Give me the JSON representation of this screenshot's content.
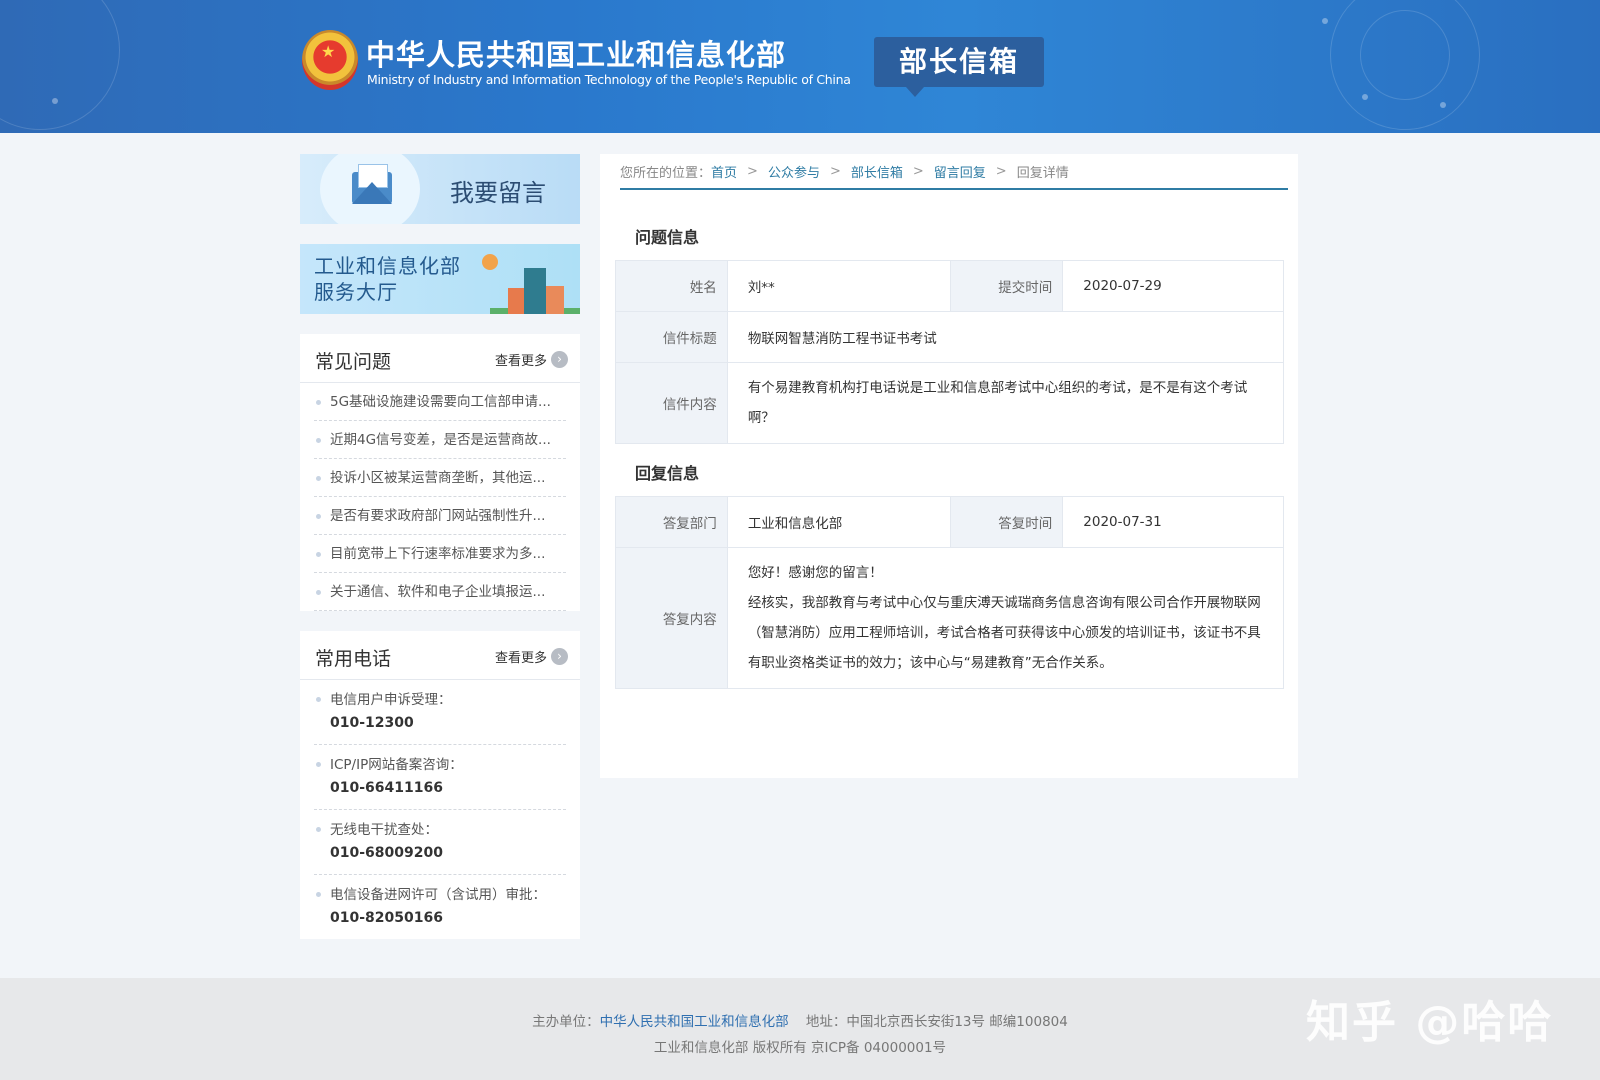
{
  "header": {
    "title_cn": "中华人民共和国工业和信息化部",
    "title_en": "Ministry of Industry and Information Technology of the People's Republic of China",
    "badge": "部长信箱"
  },
  "sidebar": {
    "leave_message": "我要留言",
    "service_hall_line1": "工业和信息化部",
    "service_hall_line2": "服务大厅",
    "faq": {
      "title": "常见问题",
      "more": "查看更多",
      "items": [
        "5G基础设施建设需要向工信部申请...",
        "近期4G信号变差，是否是运营商故...",
        "投诉小区被某运营商垄断，其他运...",
        "是否有要求政府部门网站强制性升...",
        "目前宽带上下行速率标准要求为多...",
        "关于通信、软件和电子企业填报运..."
      ]
    },
    "phones": {
      "title": "常用电话",
      "more": "查看更多",
      "items": [
        {
          "label": "电信用户申诉受理：",
          "number": "010-12300"
        },
        {
          "label": "ICP/IP网站备案咨询：",
          "number": "010-66411166"
        },
        {
          "label": "无线电干扰查处：",
          "number": "010-68009200"
        },
        {
          "label": "电信设备进网许可（含试用）审批：",
          "number": "010-82050166"
        }
      ]
    }
  },
  "breadcrumb": {
    "prefix": "您所在的位置：",
    "items": [
      "首页",
      "公众参与",
      "部长信箱",
      "留言回复",
      "回复详情"
    ],
    "separator": ">"
  },
  "question": {
    "section_title": "问题信息",
    "name_label": "姓名",
    "name": "刘**",
    "submit_time_label": "提交时间",
    "submit_time": "2020-07-29",
    "subject_label": "信件标题",
    "subject": "物联网智慧消防工程书证书考试",
    "content_label": "信件内容",
    "content": "有个易建教育机构打电话说是工业和信息部考试中心组织的考试，是不是有这个考试啊？"
  },
  "reply": {
    "section_title": "回复信息",
    "dept_label": "答复部门",
    "dept": "工业和信息化部",
    "time_label": "答复时间",
    "time": "2020-07-31",
    "content_label": "答复内容",
    "content_line1": "您好！感谢您的留言！",
    "content_line2": "经核实，我部教育与考试中心仅与重庆溥天诚瑞商务信息咨询有限公司合作开展物联网（智慧消防）应用工程师培训，考试合格者可获得该中心颁发的培训证书，该证书不具有职业资格类证书的效力；该中心与“易建教育”无合作关系。"
  },
  "footer": {
    "host_label": "主办单位：",
    "host_org": "中华人民共和国工业和信息化部",
    "address": "地址：中国北京西长安街13号 邮编100804",
    "copyright": "工业和信息化部 版权所有 京ICP备 04000001号"
  },
  "watermark": "知乎 @哈哈"
}
